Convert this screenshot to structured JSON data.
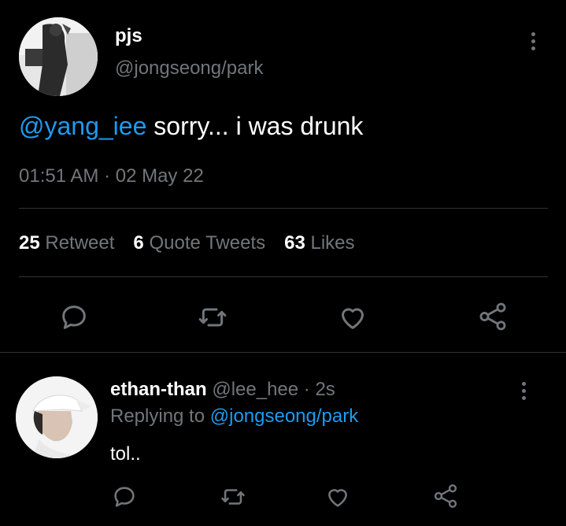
{
  "main_tweet": {
    "author_name": "pjs",
    "author_handle": "@jongseong/park",
    "mention": "@yang_iee",
    "text": " sorry... i was drunk",
    "timestamp": "01:51 AM · 02 May 22",
    "stats": {
      "retweets_count": "25",
      "retweets_label": "Retweet",
      "quotes_count": "6",
      "quotes_label": "Quote Tweets",
      "likes_count": "63",
      "likes_label": "Likes"
    }
  },
  "reply": {
    "author_name": "ethan-than",
    "author_handle": "@lee_hee",
    "time": "· 2s",
    "replying_prefix": "Replying to ",
    "replying_handle": "@jongseong/park",
    "text": "tol.."
  },
  "icons": [
    "more-vertical-icon",
    "reply-icon",
    "retweet-icon",
    "like-icon",
    "share-icon"
  ],
  "colors": {
    "background": "#000000",
    "accent": "#1d9bf0",
    "muted": "#71767b",
    "text": "#e7e9ea"
  }
}
